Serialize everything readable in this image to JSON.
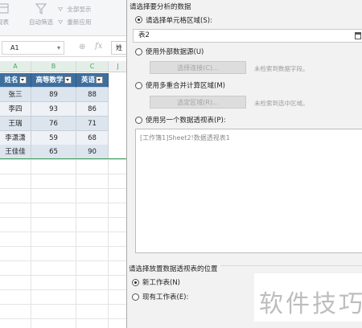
{
  "toolbar": {
    "items": [
      {
        "label": "视表",
        "icon": "pivot-icon"
      },
      {
        "label": "自动筛选",
        "icon": "filter-icon"
      },
      {
        "label": "全部显示",
        "icon": "show-all-icon"
      },
      {
        "label": "重新应用",
        "icon": "reapply-icon"
      }
    ]
  },
  "formula_bar": {
    "name_box": "A1",
    "name_box_arrow": "▾",
    "zoom_glyph": "⊕",
    "fx_glyph": "fx",
    "value": "姓"
  },
  "columns": [
    "A",
    "B",
    "C",
    "J"
  ],
  "table": {
    "headers": [
      "姓名",
      "高等数学",
      "英语"
    ],
    "rows": [
      [
        "张三",
        "89",
        "88"
      ],
      [
        "李四",
        "93",
        "86"
      ],
      [
        "王瑞",
        "76",
        "71"
      ],
      [
        "李潇潇",
        "59",
        "68"
      ],
      [
        "王佳佳",
        "65",
        "90"
      ]
    ]
  },
  "dialog": {
    "section1_title": "请选择要分析的数据",
    "opt_select_range": "请选择单元格区域(S):",
    "range_value": "表2",
    "opt_external": "使用外部数据源(U)",
    "btn_select_connection": "选择连接(C)...",
    "hint_no_field": "未检索到数据字段。",
    "opt_multi_consolidation": "使用多重合并计算区域(M)",
    "btn_select_region": "选定区域(R)...",
    "hint_no_region": "未检索到选中区域。",
    "opt_another_pivot": "使用另一个数据透视表(P):",
    "pivot_item": "[工作簿1]Sheet2!数据透视表1",
    "section2_title": "请选择放置数据透视表的位置",
    "opt_new_sheet": "新工作表(N)",
    "opt_existing_sheet": "现有工作表(E):"
  },
  "watermark": "软件技巧",
  "colors": {
    "header_bg": "#3d6f9e",
    "band_a": "#dce5ee",
    "band_b": "#eef2f7",
    "col_header_text": "#4aa564",
    "dialog_bg": "#f2f2f2"
  }
}
